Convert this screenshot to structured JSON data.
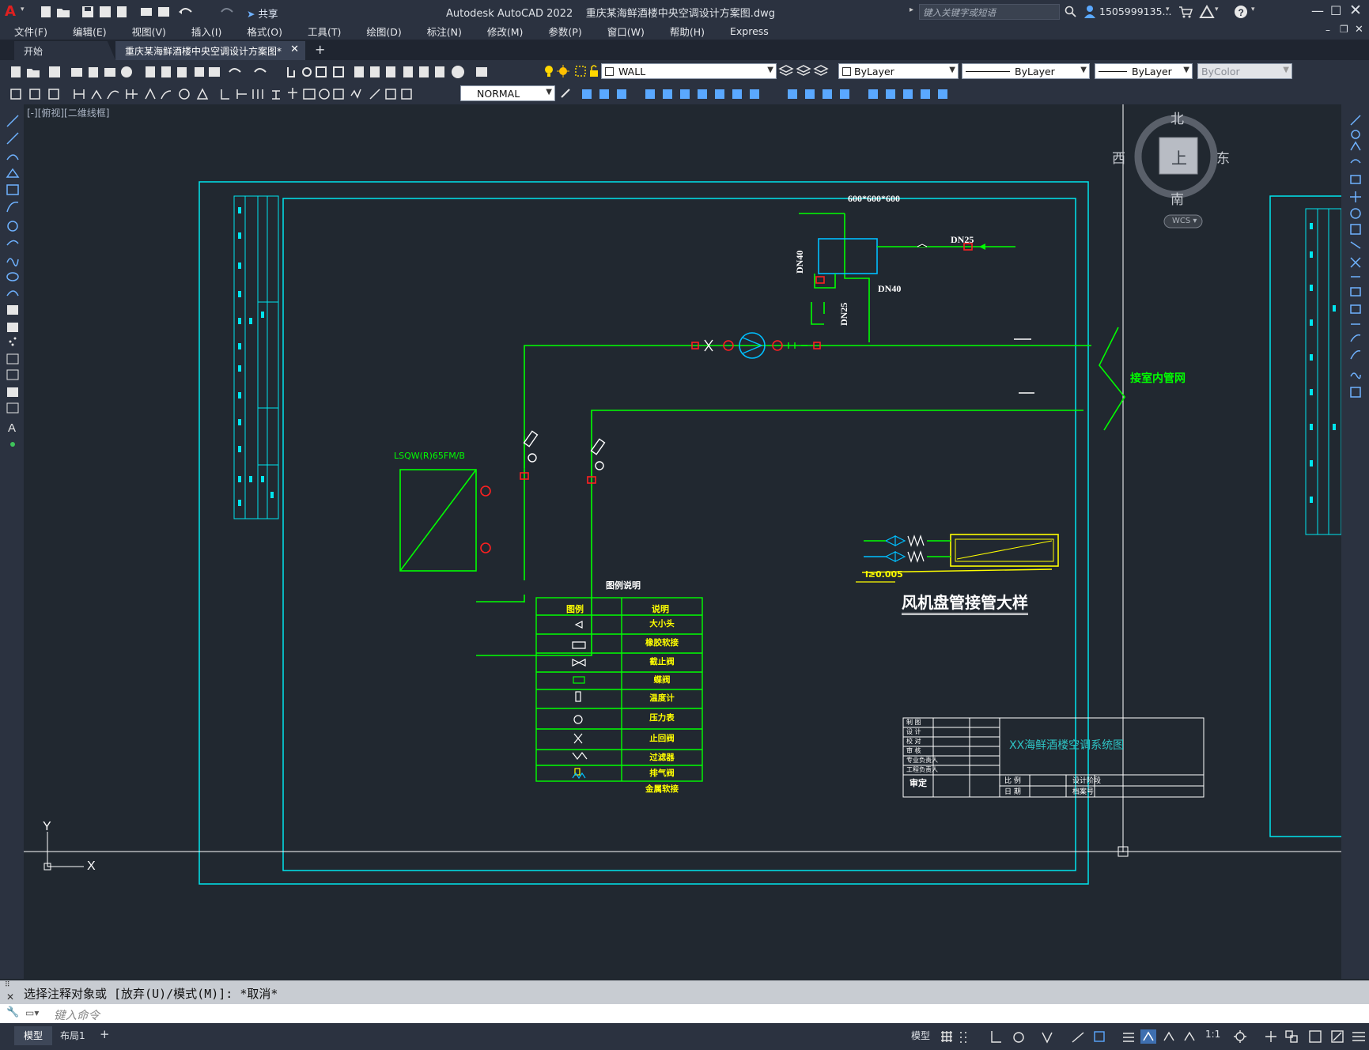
{
  "app": {
    "title": "Autodesk AutoCAD 2022",
    "filename": "重庆某海鲜酒楼中央空调设计方案图.dwg",
    "search_placeholder": "键入关键字或短语",
    "user": "1505999135...",
    "share_label": "共享"
  },
  "menu": [
    "文件(F)",
    "编辑(E)",
    "视图(V)",
    "插入(I)",
    "格式(O)",
    "工具(T)",
    "绘图(D)",
    "标注(N)",
    "修改(M)",
    "参数(P)",
    "窗口(W)",
    "帮助(H)",
    "Express"
  ],
  "tabs": {
    "start": "开始",
    "active": "重庆某海鲜酒楼中央空调设计方案图*"
  },
  "toolbar": {
    "layer": "WALL",
    "color": "ByLayer",
    "linetype": "ByLayer",
    "lineweight": "ByLayer",
    "plotstyle": "ByColor",
    "dimstyle": "NORMAL"
  },
  "viewport_label": "[-][俯视][二维线框]",
  "viewcube": {
    "north": "北",
    "south": "南",
    "east": "东",
    "west": "西",
    "face": "上",
    "wcs": "WCS"
  },
  "drawing": {
    "tank_label": "600*600*600",
    "dn25_top": "DN25",
    "dn40_vert": "DN40",
    "dn40_horiz": "DN40",
    "dn25_vert": "DN25",
    "connect_label": "接室内管网",
    "unit_label": "LSQW(R)65FM/B",
    "legend_title": "图例说明",
    "legend_header": [
      "图例",
      "说明"
    ],
    "legend_items": [
      "大小头",
      "橡胶软接",
      "截止阀",
      "蝶阀",
      "温度计",
      "压力表",
      "止回阀",
      "过滤器",
      "排气阀",
      "金属软接"
    ],
    "fcu_title": "风机盘管接管大样",
    "slope_label": "i≥0.005",
    "titleblock_name": "XX海鲜酒楼空调系统图",
    "tb_left": [
      "制 图",
      "设 计",
      "校 对",
      "审 核",
      "专业负责人",
      "工程负责人"
    ],
    "tb_approve": "审定",
    "tb_scale": "比 例",
    "tb_date": "日 期",
    "tb_stage": "设计阶段",
    "tb_fileno": "档案号"
  },
  "command": {
    "history": "选择注释对象或 [放弃(U)/模式(M)]: *取消*",
    "placeholder": "键入命令"
  },
  "status": {
    "model": "模型",
    "layout1": "布局1",
    "scale": "1:1"
  },
  "colors": {
    "green": "#00ff00",
    "cyan": "#00e5ee",
    "red": "#ff2020",
    "yellow": "#ffff00",
    "blue": "#00bfff",
    "bg": "#212830"
  }
}
